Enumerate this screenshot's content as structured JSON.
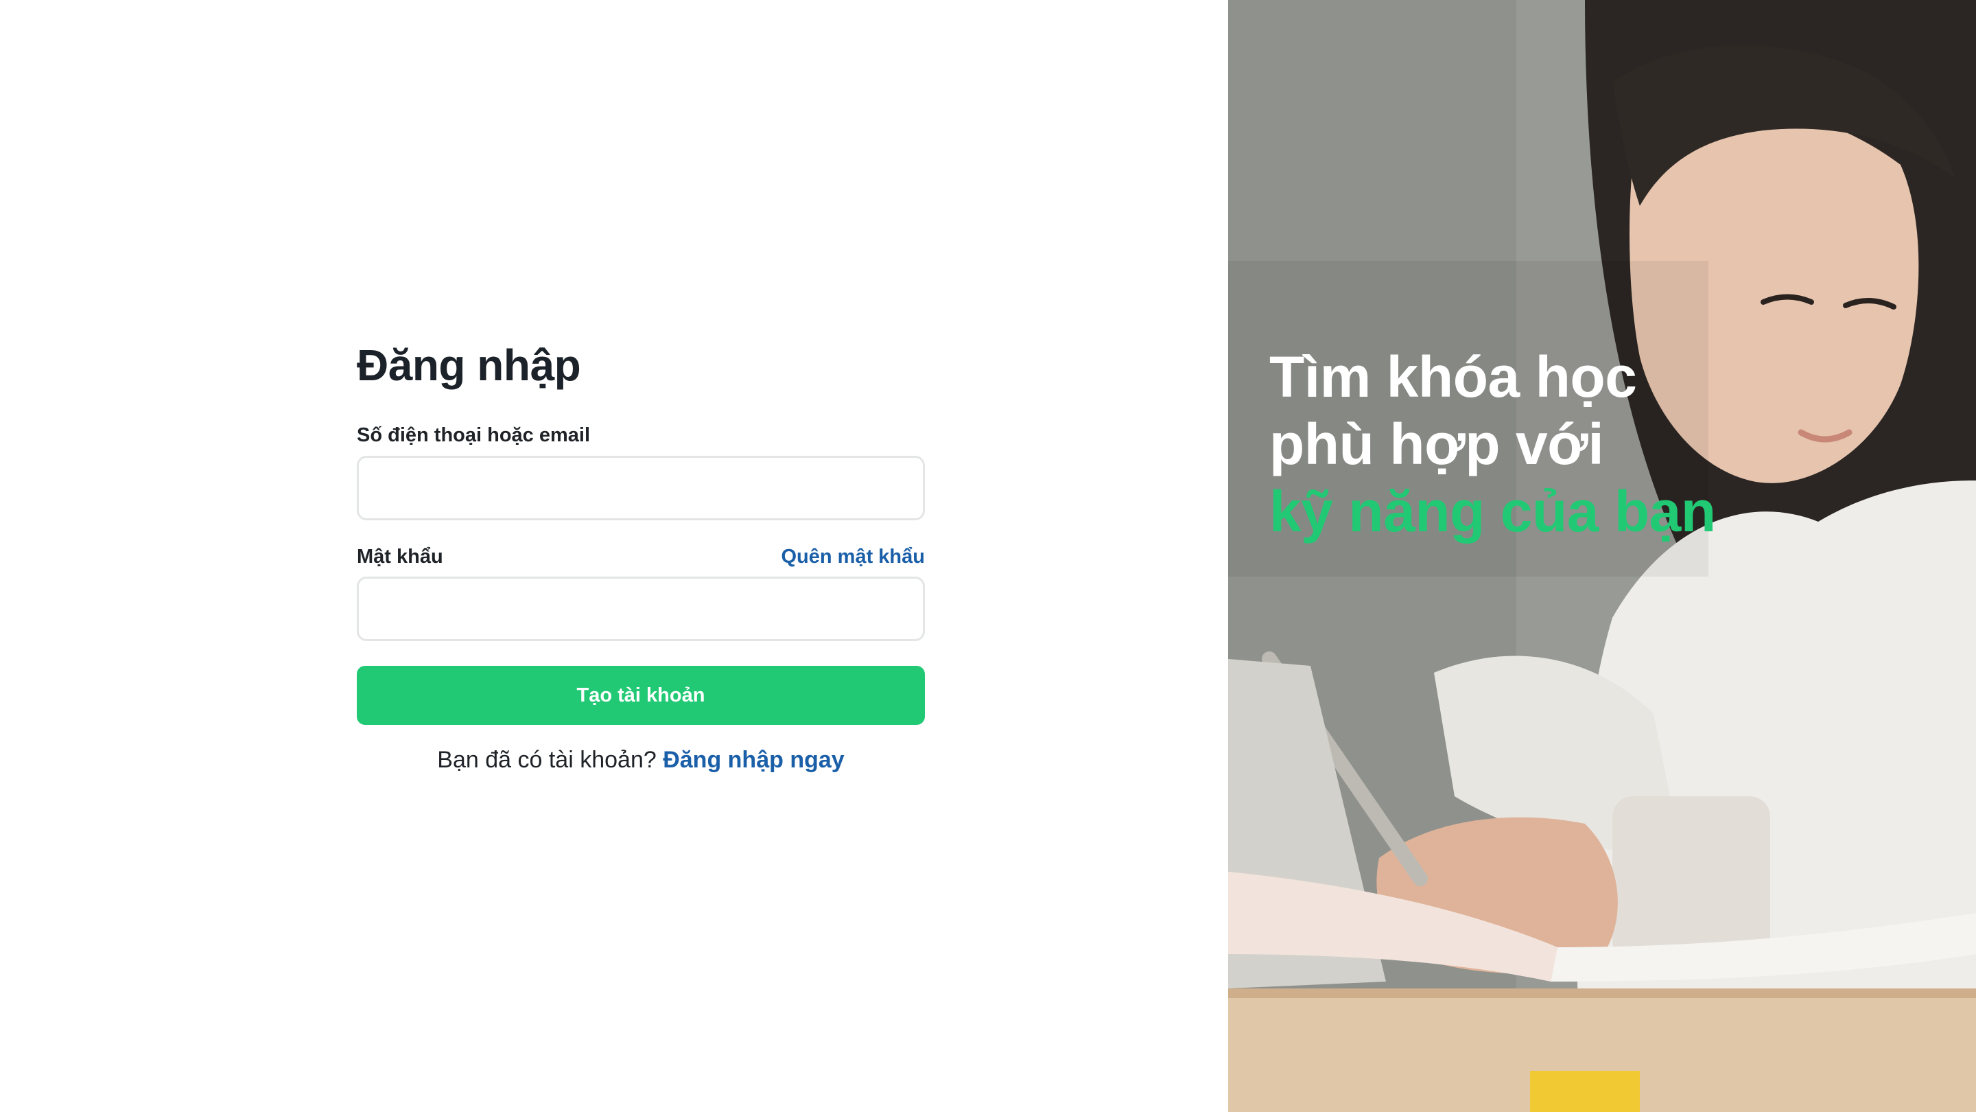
{
  "login_form": {
    "title": "Đăng nhập",
    "email_label": "Số điện thoại hoặc email",
    "email_value": "",
    "email_placeholder": "",
    "password_label": "Mật khẩu",
    "password_value": "",
    "password_placeholder": "",
    "forgot_password_link": "Quên mật khẩu",
    "submit_button": "Tạo tài khoản",
    "account_prompt": "Bạn đã có tài khoản?",
    "login_now_link": "Đăng nhập ngay"
  },
  "hero": {
    "line1": "Tìm khóa học",
    "line2": "phù hợp với",
    "line3": "kỹ năng của bạn"
  },
  "colors": {
    "accent_green": "#22c975",
    "link_blue": "#1a5fa8",
    "title_text": "#1c2229"
  }
}
